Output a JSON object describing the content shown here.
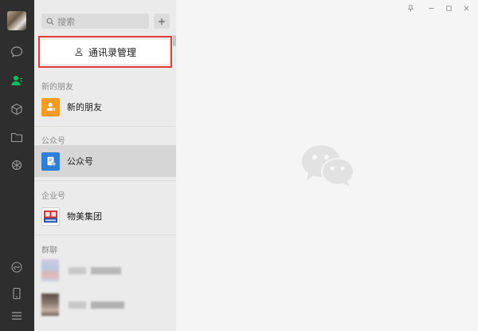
{
  "search": {
    "placeholder": "搜索"
  },
  "manage_button": {
    "label": "通讯录管理"
  },
  "sections": {
    "new_friends": {
      "label": "新的朋友",
      "item": "新的朋友"
    },
    "official_accounts": {
      "label": "公众号",
      "item": "公众号"
    },
    "enterprise": {
      "label": "企业号",
      "item": "物美集团"
    },
    "groups": {
      "label": "群聊"
    }
  },
  "icons": {
    "rail": [
      "avatar",
      "chat-icon",
      "contacts-icon",
      "favorites-icon",
      "files-icon",
      "moments-icon",
      "mini-program-icon",
      "phone-icon",
      "menu-icon"
    ],
    "window": [
      "pin-icon",
      "minimize-icon",
      "maximize-icon",
      "close-icon"
    ]
  },
  "colors": {
    "rail_bg": "#2e2e2e",
    "list_bg": "#ebebeb",
    "main_bg": "#f5f5f5",
    "accent_green": "#07c160",
    "highlight_red": "#e03c3c"
  }
}
